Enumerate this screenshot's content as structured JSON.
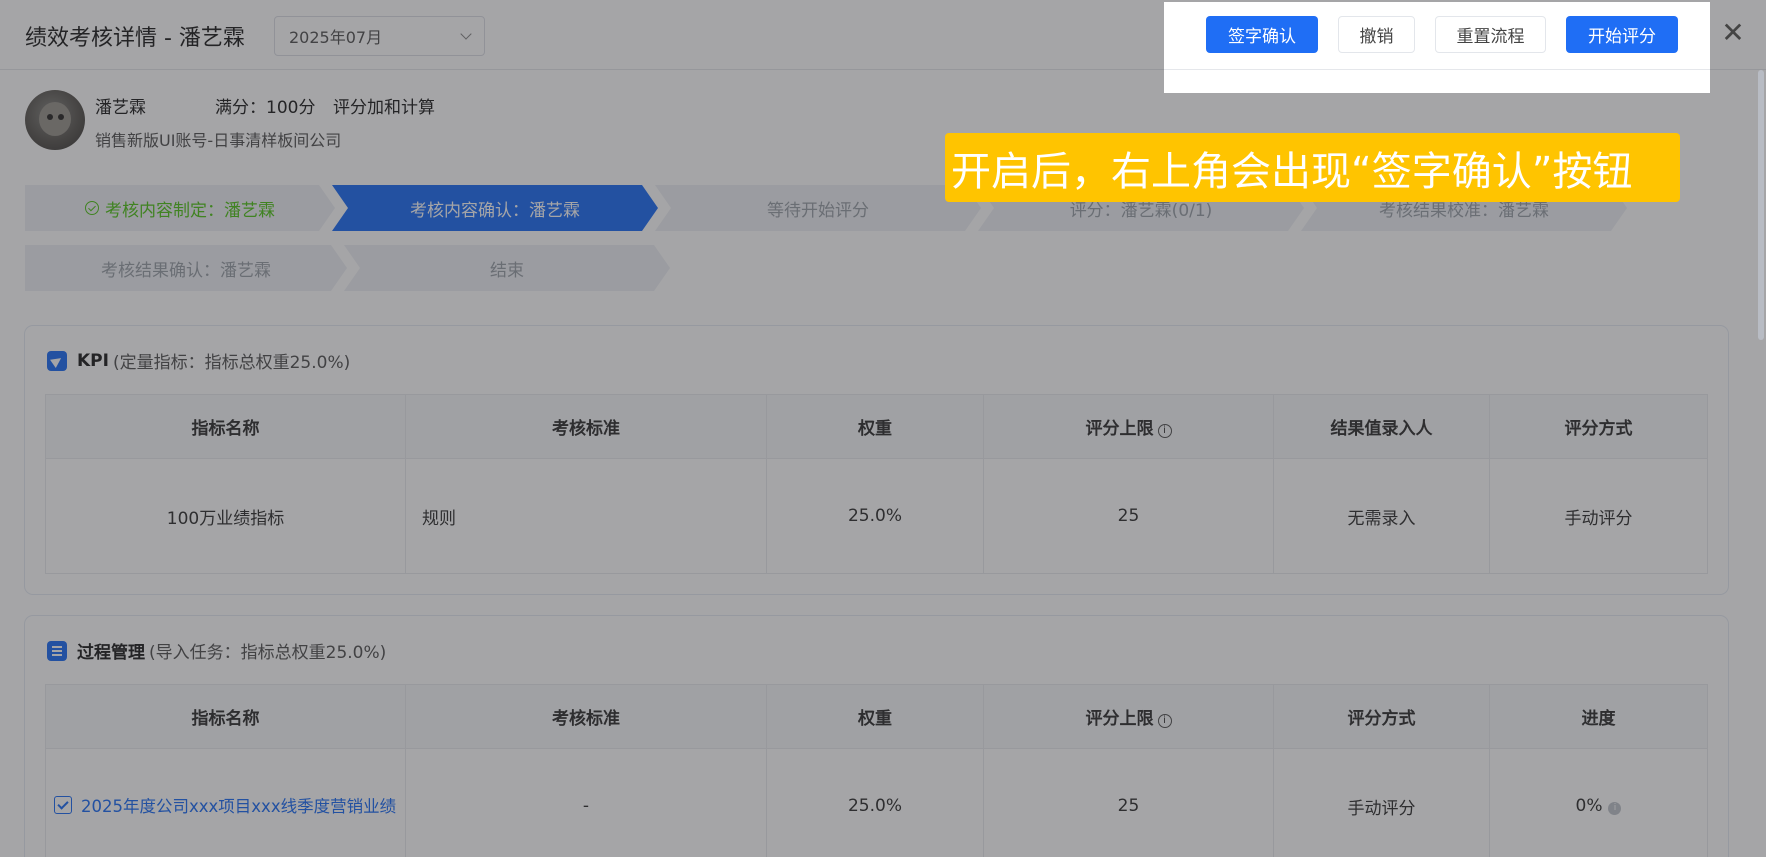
{
  "header": {
    "title": "绩效考核详情 - 潘艺霖",
    "month": "2025年07月",
    "close_icon": "close-icon"
  },
  "toolbar": {
    "sign_confirm": "签字确认",
    "revoke": "撤销",
    "reset_flow": "重置流程",
    "start_scoring": "开始评分"
  },
  "profile": {
    "name": "潘艺霖",
    "full_score": "满分：100分",
    "method": "评分加和计算",
    "company": "销售新版UI账号-日事清样板间公司"
  },
  "steps": [
    {
      "label": "考核内容制定：潘艺霖",
      "status": "done"
    },
    {
      "label": "考核内容确认：潘艺霖",
      "status": "active"
    },
    {
      "label": "等待开始评分",
      "status": "pending"
    },
    {
      "label": "评分：潘艺霖(0/1)",
      "status": "pending"
    },
    {
      "label": "考核结果校准：潘艺霖",
      "status": "pending"
    },
    {
      "label": "考核结果确认：潘艺霖",
      "status": "pending"
    },
    {
      "label": "结束",
      "status": "pending"
    }
  ],
  "kpi": {
    "title": "KPI",
    "subtitle": "(定量指标：指标总权重25.0%)",
    "headers": [
      "指标名称",
      "考核标准",
      "权重",
      "评分上限",
      "结果值录入人",
      "评分方式"
    ],
    "rows": [
      {
        "name": "100万业绩指标",
        "standard": "规则",
        "weight": "25.0%",
        "limit": "25",
        "entry": "无需录入",
        "method": "手动评分"
      }
    ]
  },
  "process": {
    "title": "过程管理",
    "subtitle": "(导入任务：指标总权重25.0%)",
    "headers": [
      "指标名称",
      "考核标准",
      "权重",
      "评分上限",
      "评分方式",
      "进度"
    ],
    "rows": [
      {
        "name": "2025年度公司xxx项目xxx线季度营销业绩",
        "standard": "-",
        "weight": "25.0%",
        "limit": "25",
        "method": "手动评分",
        "progress": "0%"
      }
    ]
  },
  "annotation": "开启后，右上角会出现“签字确认”按钮"
}
